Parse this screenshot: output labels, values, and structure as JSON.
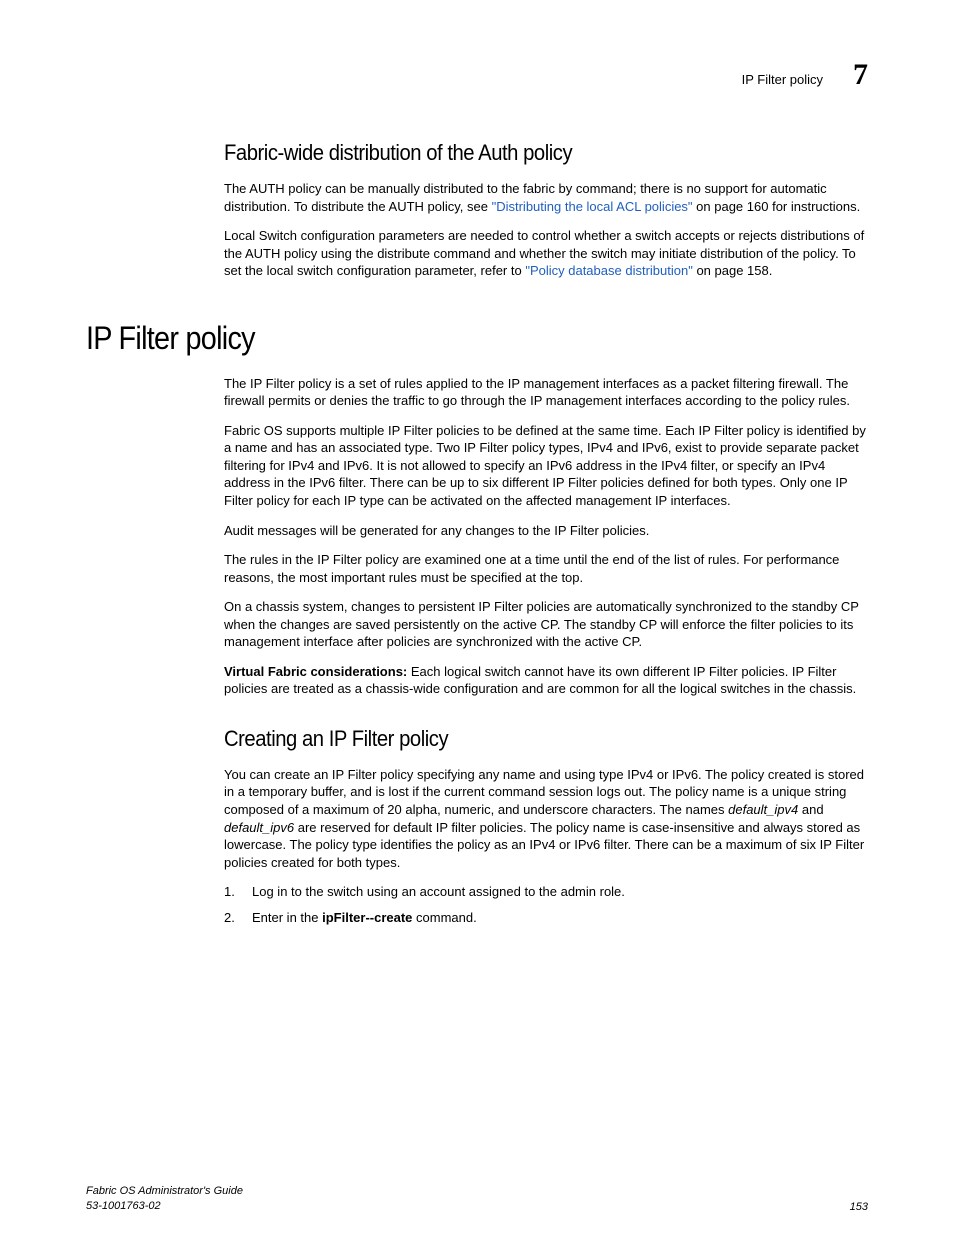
{
  "header": {
    "section_label": "IP Filter policy",
    "chapter_number": "7"
  },
  "section1": {
    "title": "Fabric-wide distribution of the Auth policy",
    "para1_a": "The AUTH policy can be manually distributed to the fabric by command; there is no support for automatic distribution. To distribute the AUTH policy, see ",
    "para1_link": "\"Distributing the local ACL policies\"",
    "para1_b": " on page 160 for instructions.",
    "para2_a": "Local Switch configuration parameters are needed to control whether a switch accepts or rejects distributions of the AUTH policy using the distribute command and whether the switch may initiate distribution of the policy. To set the local switch configuration parameter, refer to ",
    "para2_link": "\"Policy database distribution\"",
    "para2_b": " on page 158."
  },
  "major": {
    "title": "IP Filter policy",
    "para1": "The IP Filter policy is a set of rules applied to the IP management interfaces as a packet filtering firewall. The firewall permits or denies the traffic to go through the IP management interfaces according to the policy rules.",
    "para2": "Fabric OS supports multiple IP Filter policies to be defined at the same time. Each IP Filter policy is identified by a name and has an associated type. Two IP Filter policy types, IPv4 and IPv6, exist to provide separate packet filtering for IPv4 and IPv6. It is not allowed to specify an IPv6 address in the IPv4 filter, or specify an IPv4 address in the IPv6 filter. There can be up to six different IP Filter policies defined for both types. Only one IP Filter policy for each IP type can be activated on the affected management IP interfaces.",
    "para3": "Audit messages will be generated for any changes to the IP Filter policies.",
    "para4": "The rules in the IP Filter policy are examined one at a time until the end of the list of rules. For performance reasons, the most important rules must be specified at the top.",
    "para5": "On a chassis system, changes to persistent IP Filter policies are automatically synchronized to the standby CP when the changes are saved persistently on the active CP. The standby CP will enforce the filter policies to its management interface after policies are synchronized with the active CP.",
    "para6_bold": "Virtual Fabric considerations:",
    "para6_rest": " Each logical switch cannot have its own different IP Filter policies. IP Filter policies are treated as a chassis-wide configuration and are common for all the logical switches in the chassis."
  },
  "section2": {
    "title": "Creating an IP Filter policy",
    "para1_a": "You can create an IP Filter policy specifying any name and using type IPv4 or IPv6. The policy created is stored in a temporary buffer, and is lost if the current command session logs out. The policy name is a unique string composed of a maximum of 20 alpha, numeric, and underscore characters. The names ",
    "para1_i1": "default_ipv4",
    "para1_mid": " and ",
    "para1_i2": "default_ipv6",
    "para1_b": " are reserved for default IP filter policies. The policy name is case-insensitive and always stored as lowercase. The policy type identifies the policy as an IPv4 or IPv6 filter. There can be a maximum of six IP Filter policies created for both types.",
    "steps": [
      {
        "num": "1.",
        "text": "Log in to the switch using an account assigned to the admin role."
      },
      {
        "num": "2.",
        "text_a": "Enter in the ",
        "cmd": "ipFilter--create",
        "text_b": " command."
      }
    ]
  },
  "footer": {
    "title": "Fabric OS Administrator's Guide",
    "docnum": "53-1001763-02",
    "page": "153"
  }
}
